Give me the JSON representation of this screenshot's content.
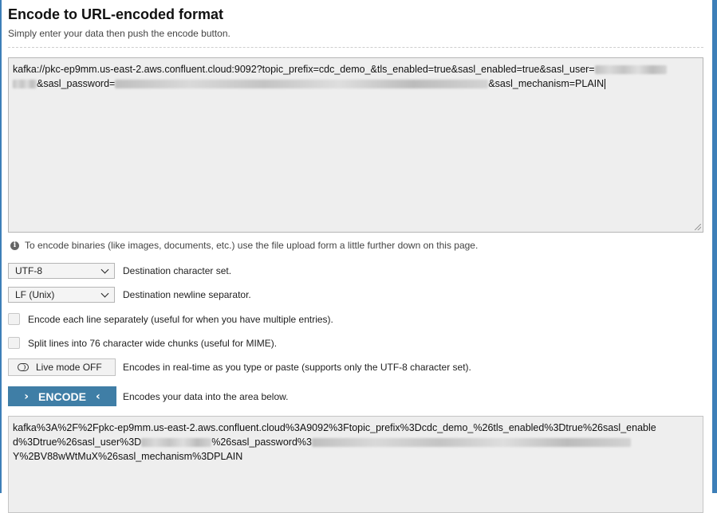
{
  "header": {
    "title": "Encode to URL-encoded format",
    "subtitle": "Simply enter your data then push the encode button."
  },
  "input": {
    "line1_part1": "kafka://pkc-ep9mm.us-east-2.aws.confluent.cloud:9092?topic_prefix=cdc_demo_&tls_enabled=true&sasl_enabled=true&sasl_user=",
    "line2_part1": "&sasl_password=",
    "line2_part2": "&sasl_mechanism=PLAIN"
  },
  "info": {
    "text": "To encode binaries (like images, documents, etc.) use the file upload form a little further down on this page."
  },
  "options": {
    "charset_value": "UTF-8",
    "charset_label": "Destination character set.",
    "newline_value": "LF (Unix)",
    "newline_label": "Destination newline separator.",
    "each_line_label": "Encode each line separately (useful for when you have multiple entries).",
    "split_label": "Split lines into 76 character wide chunks (useful for MIME).",
    "live_mode_button": "Live mode OFF",
    "live_mode_label": "Encodes in real-time as you type or paste (supports only the UTF-8 character set).",
    "encode_button": "ENCODE",
    "encode_label": "Encodes your data into the area below."
  },
  "output": {
    "line1": "kafka%3A%2F%2Fpkc-ep9mm.us-east-2.aws.confluent.cloud%3A9092%3Ftopic_prefix%3Dcdc_demo_%26tls_enabled%3Dtrue%26sasl_enable",
    "line2_part1": "d%3Dtrue%26sasl_user%3D",
    "line2_part2": "%26sasl_password%3",
    "line3": "Y%2BV88wWtMuX%26sasl_mechanism%3DPLAIN"
  }
}
